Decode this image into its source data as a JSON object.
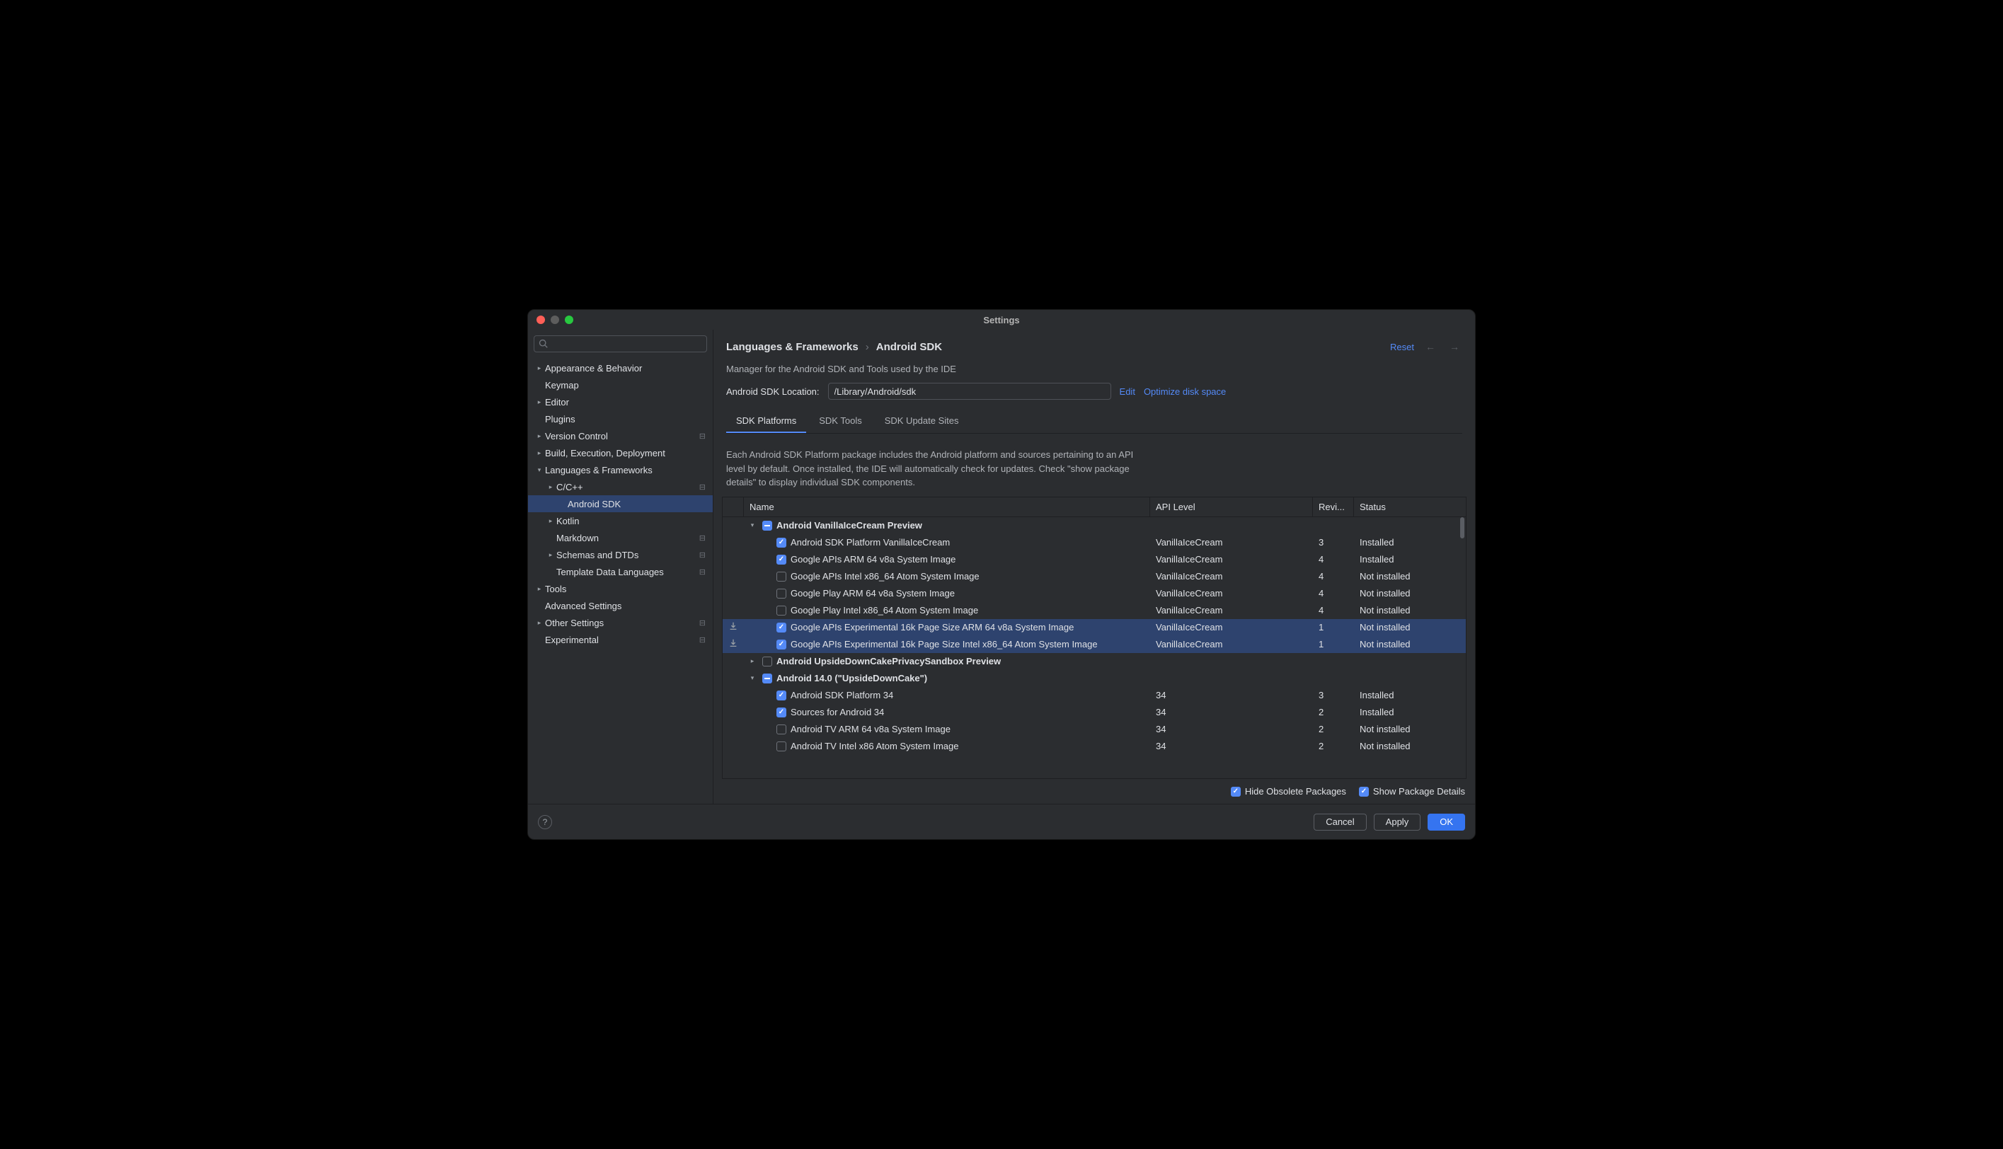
{
  "window": {
    "title": "Settings"
  },
  "sidebar": {
    "search_placeholder": "",
    "items": [
      {
        "label": "Appearance & Behavior",
        "level": 0,
        "chevron": "right",
        "badge": ""
      },
      {
        "label": "Keymap",
        "level": 0,
        "chevron": "",
        "badge": ""
      },
      {
        "label": "Editor",
        "level": 0,
        "chevron": "right",
        "badge": ""
      },
      {
        "label": "Plugins",
        "level": 0,
        "chevron": "",
        "badge": ""
      },
      {
        "label": "Version Control",
        "level": 0,
        "chevron": "right",
        "badge": "⊟"
      },
      {
        "label": "Build, Execution, Deployment",
        "level": 0,
        "chevron": "right",
        "badge": ""
      },
      {
        "label": "Languages & Frameworks",
        "level": 0,
        "chevron": "down",
        "badge": ""
      },
      {
        "label": "C/C++",
        "level": 1,
        "chevron": "right",
        "badge": "⊟"
      },
      {
        "label": "Android SDK",
        "level": 2,
        "chevron": "",
        "badge": "",
        "selected": true
      },
      {
        "label": "Kotlin",
        "level": 1,
        "chevron": "right",
        "badge": ""
      },
      {
        "label": "Markdown",
        "level": 1,
        "chevron": "",
        "badge": "⊟"
      },
      {
        "label": "Schemas and DTDs",
        "level": 1,
        "chevron": "right",
        "badge": "⊟"
      },
      {
        "label": "Template Data Languages",
        "level": 1,
        "chevron": "",
        "badge": "⊟"
      },
      {
        "label": "Tools",
        "level": 0,
        "chevron": "right",
        "badge": ""
      },
      {
        "label": "Advanced Settings",
        "level": 0,
        "chevron": "",
        "badge": ""
      },
      {
        "label": "Other Settings",
        "level": 0,
        "chevron": "right",
        "badge": "⊟"
      },
      {
        "label": "Experimental",
        "level": 0,
        "chevron": "",
        "badge": "⊟"
      }
    ]
  },
  "header": {
    "crumb1": "Languages & Frameworks",
    "crumb_sep": "›",
    "crumb2": "Android SDK",
    "reset": "Reset"
  },
  "subtitle": "Manager for the Android SDK and Tools used by the IDE",
  "location": {
    "label": "Android SDK Location:",
    "value": "/Library/Android/sdk",
    "edit": "Edit",
    "optimize": "Optimize disk space"
  },
  "tabs": [
    {
      "label": "SDK Platforms",
      "active": true
    },
    {
      "label": "SDK Tools",
      "active": false
    },
    {
      "label": "SDK Update Sites",
      "active": false
    }
  ],
  "description": "Each Android SDK Platform package includes the Android platform and sources pertaining to an API level by default. Once installed, the IDE will automatically check for updates. Check \"show package details\" to display individual SDK components.",
  "columns": {
    "name": "Name",
    "api": "API Level",
    "rev": "Revi...",
    "status": "Status"
  },
  "rows": [
    {
      "type": "group",
      "chevron": "down",
      "check": "mixed",
      "name": "Android VanillaIceCream Preview"
    },
    {
      "type": "item",
      "check": "checked",
      "name": "Android SDK Platform VanillaIceCream",
      "api": "VanillaIceCream",
      "rev": "3",
      "status": "Installed"
    },
    {
      "type": "item",
      "check": "checked",
      "name": "Google APIs ARM 64 v8a System Image",
      "api": "VanillaIceCream",
      "rev": "4",
      "status": "Installed"
    },
    {
      "type": "item",
      "check": "",
      "name": "Google APIs Intel x86_64 Atom System Image",
      "api": "VanillaIceCream",
      "rev": "4",
      "status": "Not installed"
    },
    {
      "type": "item",
      "check": "",
      "name": "Google Play ARM 64 v8a System Image",
      "api": "VanillaIceCream",
      "rev": "4",
      "status": "Not installed"
    },
    {
      "type": "item",
      "check": "",
      "name": "Google Play Intel x86_64 Atom System Image",
      "api": "VanillaIceCream",
      "rev": "4",
      "status": "Not installed"
    },
    {
      "type": "item",
      "check": "checked",
      "name": "Google APIs Experimental 16k Page Size ARM 64 v8a System Image",
      "api": "VanillaIceCream",
      "rev": "1",
      "status": "Not installed",
      "selected": true,
      "download": true
    },
    {
      "type": "item",
      "check": "checked",
      "name": "Google APIs Experimental 16k Page Size Intel x86_64 Atom System Image",
      "api": "VanillaIceCream",
      "rev": "1",
      "status": "Not installed",
      "selected": true,
      "download": true
    },
    {
      "type": "group",
      "chevron": "right",
      "check": "",
      "name": "Android UpsideDownCakePrivacySandbox Preview"
    },
    {
      "type": "group",
      "chevron": "down",
      "check": "mixed",
      "name": "Android 14.0 (\"UpsideDownCake\")"
    },
    {
      "type": "item",
      "check": "checked",
      "name": "Android SDK Platform 34",
      "api": "34",
      "rev": "3",
      "status": "Installed"
    },
    {
      "type": "item",
      "check": "checked",
      "name": "Sources for Android 34",
      "api": "34",
      "rev": "2",
      "status": "Installed"
    },
    {
      "type": "item",
      "check": "",
      "name": "Android TV ARM 64 v8a System Image",
      "api": "34",
      "rev": "2",
      "status": "Not installed"
    },
    {
      "type": "item",
      "check": "",
      "name": "Android TV Intel x86 Atom System Image",
      "api": "34",
      "rev": "2",
      "status": "Not installed"
    }
  ],
  "options": {
    "hide": "Hide Obsolete Packages",
    "details": "Show Package Details"
  },
  "buttons": {
    "cancel": "Cancel",
    "apply": "Apply",
    "ok": "OK"
  }
}
